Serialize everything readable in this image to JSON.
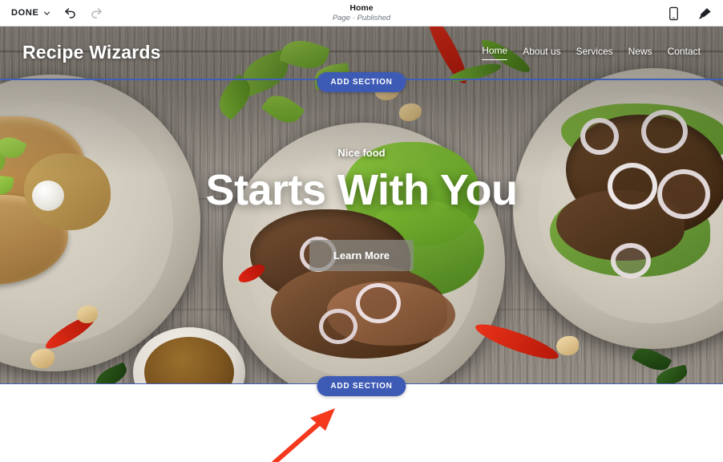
{
  "editor_bar": {
    "done_label": "DONE",
    "done_icon": "chevron-down-icon",
    "undo_icon": "undo-arrow-icon",
    "redo_icon": "redo-arrow-icon",
    "page_title": "Home",
    "page_status": "Page · Published",
    "mobile_icon": "mobile-preview-icon",
    "theme_icon": "paint-brush-icon"
  },
  "site": {
    "logo": "Recipe Wizards",
    "nav": [
      {
        "label": "Home",
        "active": true
      },
      {
        "label": "About us",
        "active": false
      },
      {
        "label": "Services",
        "active": false
      },
      {
        "label": "News",
        "active": false
      },
      {
        "label": "Contact",
        "active": false
      }
    ]
  },
  "hero": {
    "eyebrow": "Nice food",
    "headline": "Starts With You",
    "cta_label": "Learn More"
  },
  "overlays": {
    "add_section_top": "ADD SECTION",
    "add_section_bottom": "ADD SECTION",
    "annotation_arrow": "red-arrow-icon"
  },
  "colors": {
    "accent_blue": "#3d5ab5",
    "section_outline": "#3f5fb8",
    "annotation_red": "#f4391c",
    "bar_background": "#ffffff",
    "hero_text": "#ffffff"
  }
}
